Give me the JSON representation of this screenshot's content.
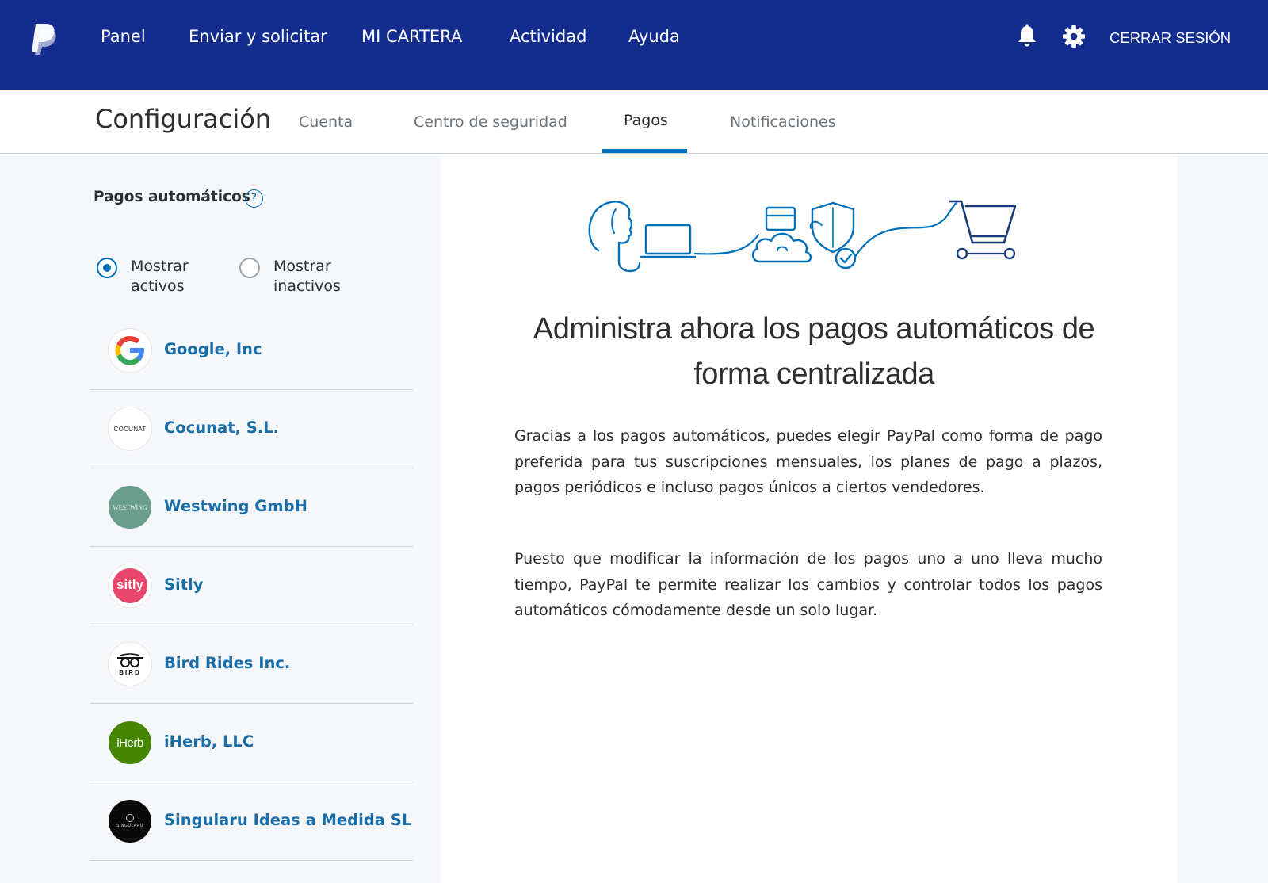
{
  "colors": {
    "nav_bg": "#142c8e",
    "accent": "#0070ba",
    "link": "#1a6ea8",
    "panel_bg": "#f5f7fa"
  },
  "topnav": {
    "logo_icon": "paypal-logo",
    "items": [
      {
        "label": "Panel"
      },
      {
        "label": "Enviar y solicitar"
      },
      {
        "label": "MI CARTERA"
      },
      {
        "label": "Actividad"
      },
      {
        "label": "Ayuda"
      }
    ],
    "notifications_icon": "bell-icon",
    "settings_icon": "gear-icon",
    "logout_label": "CERRAR SESIÓN"
  },
  "settings": {
    "title": "Configuración",
    "tabs": [
      {
        "label": "Cuenta",
        "active": false
      },
      {
        "label": "Centro de seguridad",
        "active": false
      },
      {
        "label": "Pagos",
        "active": true
      },
      {
        "label": "Notificaciones",
        "active": false
      }
    ]
  },
  "sidebar": {
    "section_title": "Pagos automáticos",
    "help_label": "?",
    "filters": [
      {
        "label": "Mostrar activos",
        "selected": true
      },
      {
        "label": "Mostrar inactivos",
        "selected": false
      }
    ],
    "merchants": [
      {
        "name": "Google, Inc",
        "logo": "google-logo"
      },
      {
        "name": "Cocunat, S.L.",
        "logo": "cocunat-logo",
        "logo_text": "COCUNAT"
      },
      {
        "name": "Westwing GmbH",
        "logo": "westwing-logo",
        "logo_text": "WESTWING"
      },
      {
        "name": "Sitly",
        "logo": "sitly-logo",
        "logo_text": "sitly"
      },
      {
        "name": "Bird Rides Inc.",
        "logo": "bird-logo",
        "logo_text": "BIRD"
      },
      {
        "name": "iHerb, LLC",
        "logo": "iherb-logo",
        "logo_text": "iHerb"
      },
      {
        "name": "Singularu Ideas a Medida SL",
        "logo": "singularu-logo",
        "logo_text": "SINGULARU"
      }
    ]
  },
  "main": {
    "illustration": "automatic-payments-illustration",
    "headline": "Administra ahora los pagos automáticos de forma centralizada",
    "paragraphs": [
      "Gracias a los pagos automáticos, puedes elegir PayPal como forma de pago preferida para tus suscripciones mensuales, los planes de pago a plazos, pagos periódicos e incluso pagos únicos a ciertos vendedores.",
      "Puesto que modificar la información de los pagos uno a uno lleva mucho tiempo, PayPal te permite realizar los cambios y controlar todos los pagos automáticos cómodamente desde un solo lugar."
    ]
  }
}
